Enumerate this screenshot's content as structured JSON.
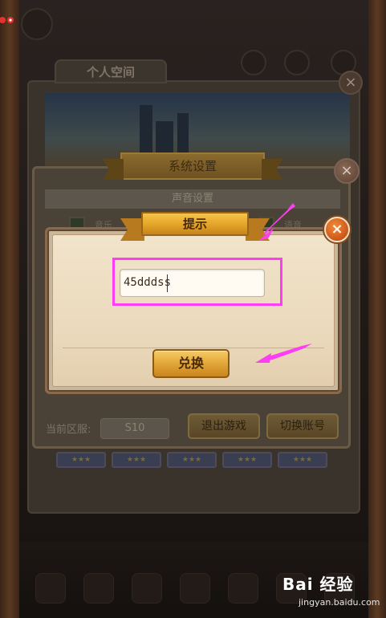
{
  "background": {
    "space_tab_label": "个人空间",
    "close_glyph": "×"
  },
  "settings": {
    "title": "系统设置",
    "close_glyph": "×",
    "sound_header": "声音设置",
    "music_label": "音乐",
    "effect_label": "语音",
    "server_label": "当前区服:",
    "server_value": "S10",
    "logout_label": "退出游戏",
    "switch_account_label": "切换账号"
  },
  "hint_dialog": {
    "title": "提示",
    "close_glyph": "×",
    "code_input_value": "45dddss",
    "redeem_label": "兑换"
  },
  "colors": {
    "annotation": "#ff3df5",
    "button_gold": "#e2a637",
    "close_orange": "#d35e1c"
  },
  "icons": {
    "hint_close": "close-icon",
    "settings_close": "close-icon",
    "space_close": "close-icon",
    "pointer": "arrow-icon"
  },
  "watermark": {
    "logo": "Bai 经验",
    "url": "jingyan.baidu.com"
  }
}
